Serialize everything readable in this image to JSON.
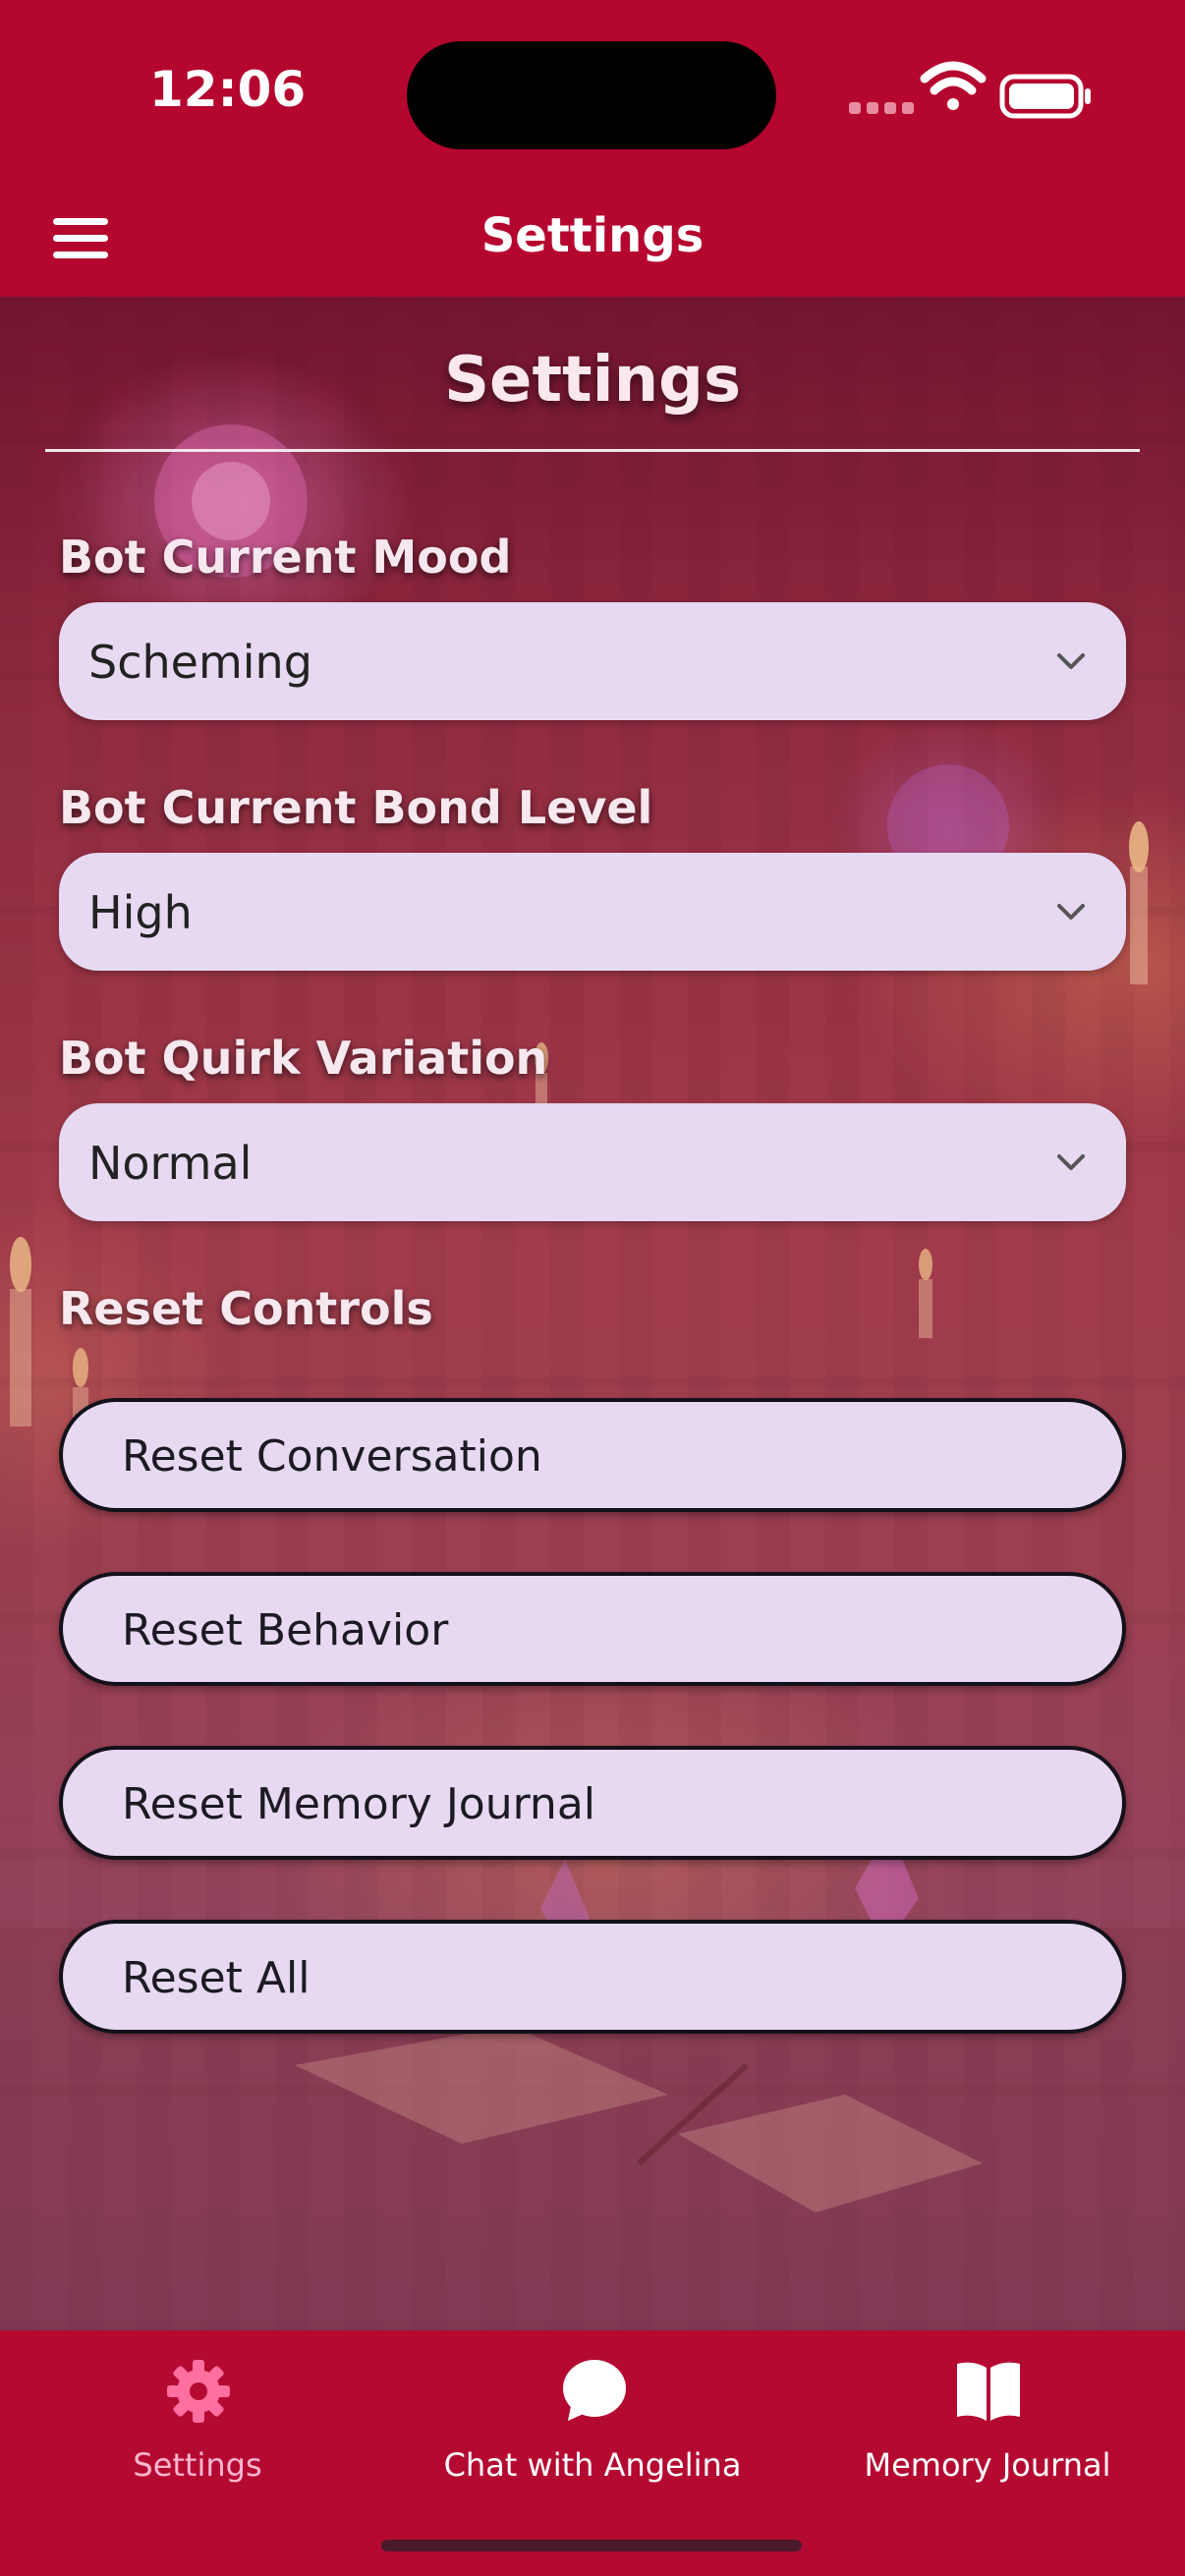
{
  "status_bar": {
    "time": "12:06"
  },
  "app_bar": {
    "title": "Settings"
  },
  "page": {
    "heading": "Settings",
    "mood": {
      "label": "Bot Current Mood",
      "value": "Scheming"
    },
    "bond": {
      "label": "Bot Current Bond Level",
      "value": "High"
    },
    "quirk": {
      "label": "Bot Quirk Variation",
      "value": "Normal"
    },
    "reset": {
      "label": "Reset Controls",
      "buttons": [
        "Reset Conversation",
        "Reset Behavior",
        "Reset Memory Journal",
        "Reset All"
      ]
    }
  },
  "tabs": [
    {
      "label": "Settings",
      "icon": "gear-icon",
      "active": true
    },
    {
      "label": "Chat with Angelina",
      "icon": "chat-bubble-icon",
      "active": false
    },
    {
      "label": "Memory Journal",
      "icon": "book-icon",
      "active": false
    }
  ],
  "colors": {
    "primary": "#b5062f",
    "field_bg": "#e6d9f1",
    "active_tab": "#ff6fa0"
  }
}
